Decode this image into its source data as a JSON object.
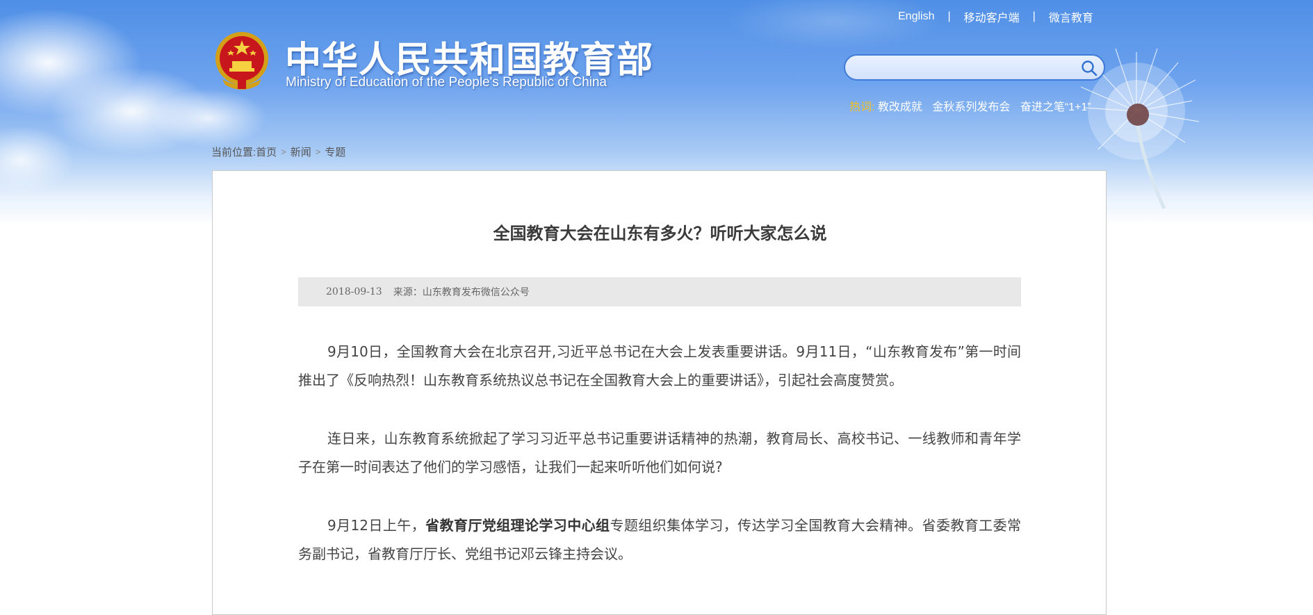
{
  "header": {
    "title_cn": "中华人民共和国教育部",
    "title_en": "Ministry of Education of the People's Republic of China",
    "links": [
      {
        "label": "English"
      },
      {
        "label": "移动客户端"
      },
      {
        "label": "微言教育"
      }
    ],
    "link_separator": "|",
    "search": {
      "placeholder": "",
      "value": ""
    },
    "hot": {
      "label": "热词:",
      "terms": [
        "教改成就",
        "金秋系列发布会",
        "奋进之笔“1+1”"
      ]
    }
  },
  "breadcrumb": {
    "prefix": "当前位置:",
    "items": [
      "首页",
      "新闻",
      "专题"
    ],
    "separator": ">"
  },
  "article": {
    "title": "全国教育大会在山东有多火？听听大家怎么说",
    "date": "2018-09-13",
    "source": "来源：山东教育发布微信公众号",
    "paragraphs": [
      {
        "text": "9月10日，全国教育大会在北京召开,习近平总书记在大会上发表重要讲话。9月11日，“山东教育发布”第一时间推出了《反响热烈！山东教育系统热议总书记在全国教育大会上的重要讲话》，引起社会高度赞赏。"
      },
      {
        "text": "连日来，山东教育系统掀起了学习习近平总书记重要讲话精神的热潮，教育局长、高校书记、一线教师和青年学子在第一时间表达了他们的学习感悟，让我们一起来听听他们如何说?"
      },
      {
        "before": "9月12日上午，",
        "bold": "省教育厅党组理论学习中心组",
        "after": "专题组织集体学习，传达学习全国教育大会精神。省委教育工委常务副书记，省教育厅厅长、党组书记邓云锋主持会议。"
      }
    ]
  },
  "colors": {
    "sky_top": "#4f8fe6",
    "hot_label": "#f5c11d",
    "search_border": "#3e7ad6",
    "meta_bg": "#e8e8e8",
    "panel_border": "#c9c9c9"
  }
}
